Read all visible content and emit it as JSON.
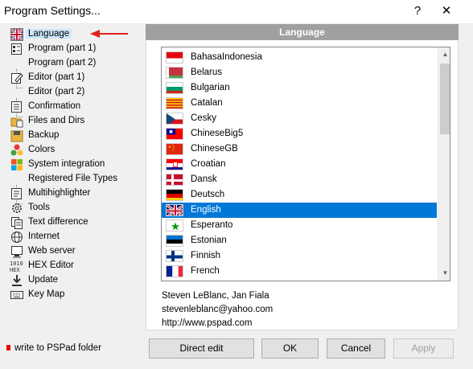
{
  "window": {
    "title": "Program Settings...",
    "help_label": "?",
    "close_label": "✕"
  },
  "tree": {
    "items": [
      {
        "label": "Language",
        "icon": "uk-flag-icon"
      },
      {
        "label": "Program  (part 1)",
        "icon": "program-settings-icon"
      },
      {
        "label": "Program  (part 2)",
        "icon": ""
      },
      {
        "label": "Editor  (part 1)",
        "icon": "editor-icon"
      },
      {
        "label": "Editor  (part 2)",
        "icon": ""
      },
      {
        "label": "Confirmation",
        "icon": "confirmation-icon"
      },
      {
        "label": "Files and Dirs",
        "icon": "folder-icon"
      },
      {
        "label": "Backup",
        "icon": "backup-icon"
      },
      {
        "label": "Colors",
        "icon": "colors-icon"
      },
      {
        "label": "System integration",
        "icon": "windows-icon"
      },
      {
        "label": "Registered File Types",
        "icon": ""
      },
      {
        "label": "Multihighlighter",
        "icon": "multihighlighter-icon"
      },
      {
        "label": "Tools",
        "icon": "tools-icon"
      },
      {
        "label": "Text difference",
        "icon": "text-difference-icon"
      },
      {
        "label": "Internet",
        "icon": "globe-icon"
      },
      {
        "label": "Web server",
        "icon": "web-server-icon"
      },
      {
        "label": "HEX Editor",
        "icon": "hex-editor-icon"
      },
      {
        "label": "Update",
        "icon": "download-icon"
      },
      {
        "label": "Key Map",
        "icon": "keyboard-icon"
      }
    ]
  },
  "header": {
    "title": "Language"
  },
  "languages": {
    "items": [
      {
        "name": "BahasaIndonesia",
        "flag": "indonesia-flag-icon"
      },
      {
        "name": "Belarus",
        "flag": "belarus-flag-icon"
      },
      {
        "name": "Bulgarian",
        "flag": "bulgaria-flag-icon"
      },
      {
        "name": "Catalan",
        "flag": "catalonia-flag-icon"
      },
      {
        "name": "Cesky",
        "flag": "czech-flag-icon"
      },
      {
        "name": "ChineseBig5",
        "flag": "taiwan-flag-icon"
      },
      {
        "name": "ChineseGB",
        "flag": "china-flag-icon"
      },
      {
        "name": "Croatian",
        "flag": "croatia-flag-icon"
      },
      {
        "name": "Dansk",
        "flag": "denmark-flag-icon"
      },
      {
        "name": "Deutsch",
        "flag": "germany-flag-icon"
      },
      {
        "name": "English",
        "flag": "uk-flag-icon"
      },
      {
        "name": "Esperanto",
        "flag": "esperanto-flag-icon"
      },
      {
        "name": "Estonian",
        "flag": "estonia-flag-icon"
      },
      {
        "name": "Finnish",
        "flag": "finland-flag-icon"
      },
      {
        "name": "French",
        "flag": "france-flag-icon"
      }
    ],
    "selected": "English"
  },
  "info": {
    "authors": "Steven LeBlanc, Jan Fiala",
    "email": "stevenleblanc@yahoo.com",
    "url": "http://www.pspad.com"
  },
  "footer": {
    "write_note": "write to PSPad folder",
    "direct_edit": "Direct edit",
    "ok": "OK",
    "cancel": "Cancel",
    "apply": "Apply"
  },
  "colors": {
    "selection": "#0078d7",
    "header_bg": "#a0a0a0",
    "tree_selection": "#cce8ff",
    "arrow": "#e02020"
  }
}
